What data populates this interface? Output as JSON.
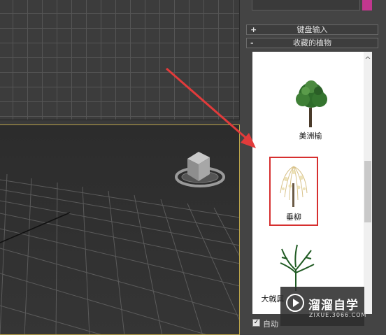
{
  "panel": {
    "rollouts": [
      {
        "toggle": "+",
        "label": "键盘输入"
      },
      {
        "toggle": "-",
        "label": "收藏的植物"
      }
    ],
    "accent_color": "#c2378f"
  },
  "plants": {
    "items": [
      {
        "name": "美洲榆",
        "icon": "elm-tree-icon"
      },
      {
        "name": "垂柳",
        "icon": "weeping-willow-icon",
        "selected": true
      },
      {
        "name": "大戟属",
        "icon": "euphorbia-icon"
      }
    ],
    "scroll_up_glyph": "^"
  },
  "auto_option": {
    "label": "自动",
    "checked": true
  },
  "watermark": {
    "title": "溜溜自学",
    "url": "ZIXUE.3066.COM"
  },
  "annotation": {
    "arrow_color": "#e23b3b",
    "highlight_color": "#d62f2f"
  }
}
